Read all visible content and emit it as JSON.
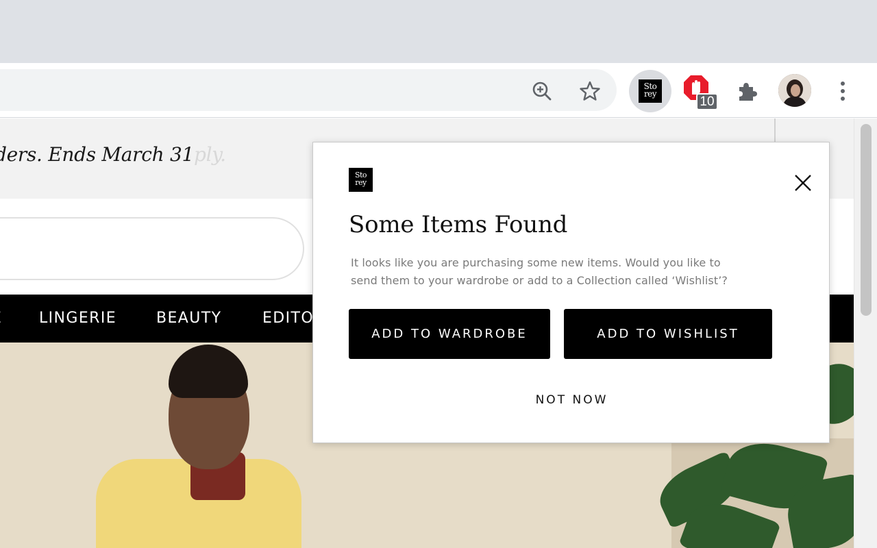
{
  "browser": {
    "extensions": {
      "storey_logo_text": "Sto rey",
      "adblock_count": "10"
    },
    "icons": [
      "zoom-in-icon",
      "star-icon",
      "storey-extension-icon",
      "adblock-icon",
      "puzzle-icon",
      "avatar",
      "kebab-menu-icon"
    ]
  },
  "page": {
    "promo_text": "ders. Ends March 31",
    "promo_faded_text": "ply.",
    "nav_items": [
      "LINGERIE",
      "BEAUTY",
      "EDITO"
    ]
  },
  "popup": {
    "logo_text_line1": "Sto",
    "logo_text_line2": "rey",
    "title": "Some Items Found",
    "body_line1": "It looks like you are purchasing some new items. Would you like to",
    "body_line2": "send them to your wardrobe or add to a Collection called ‘Wishlist’?",
    "btn_wardrobe": "ADD TO WARDROBE",
    "btn_wishlist": "ADD TO WISHLIST",
    "btn_not_now": "NOT NOW"
  },
  "colors": {
    "tabstrip": "#dee1e6",
    "nav_bg": "#000000",
    "button_bg": "#000000",
    "adblock_red": "#e81c2b"
  }
}
